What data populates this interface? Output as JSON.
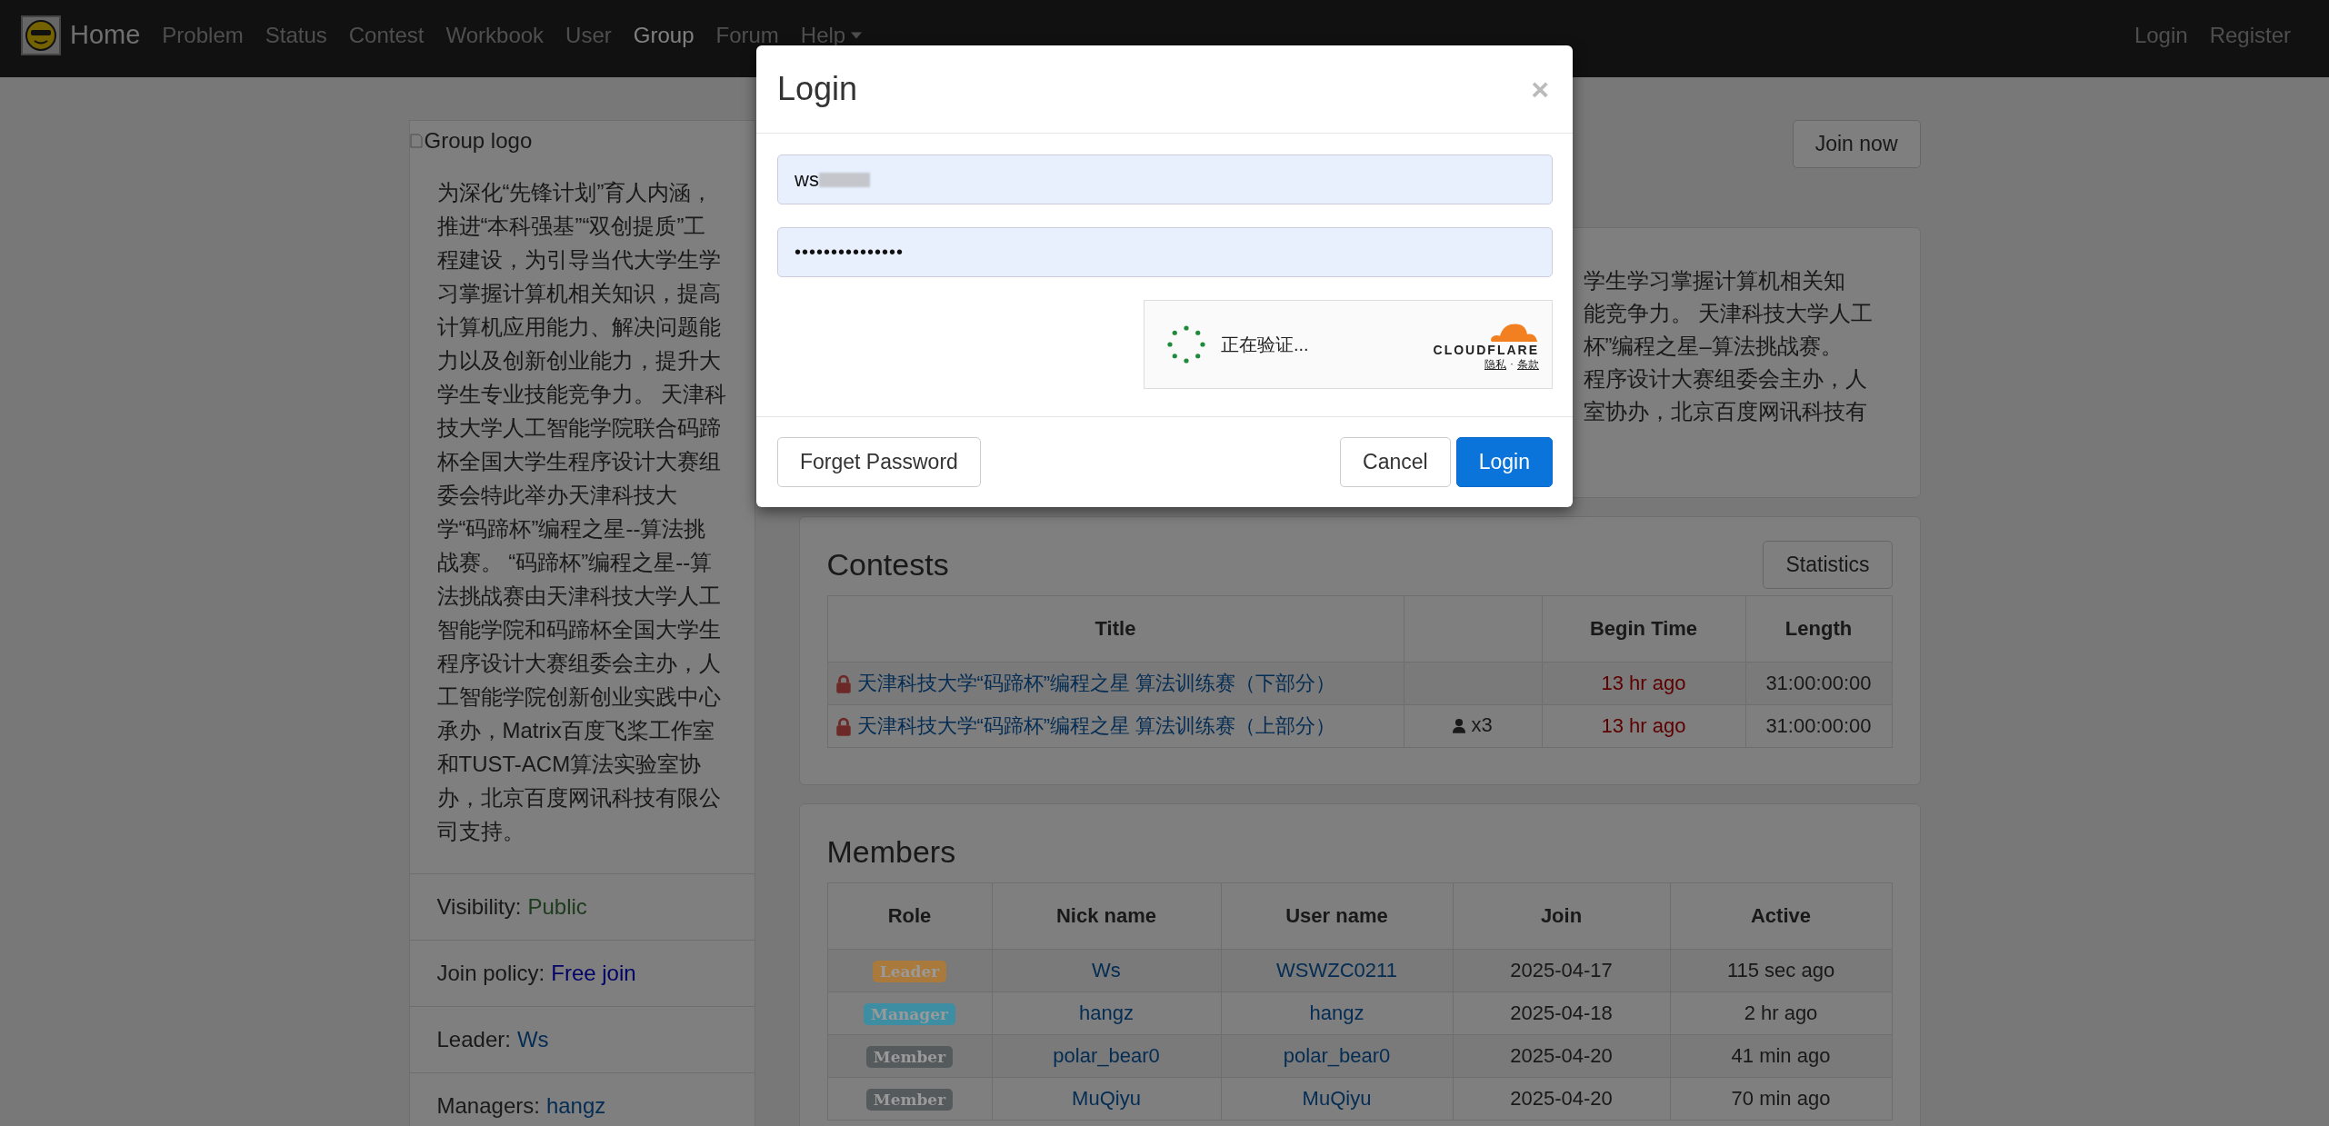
{
  "navbar": {
    "brand": "Home",
    "items": [
      {
        "label": "Problem",
        "selected": false,
        "dropdown": false
      },
      {
        "label": "Status",
        "selected": false,
        "dropdown": false
      },
      {
        "label": "Contest",
        "selected": false,
        "dropdown": false
      },
      {
        "label": "Workbook",
        "selected": false,
        "dropdown": false
      },
      {
        "label": "User",
        "selected": false,
        "dropdown": false
      },
      {
        "label": "Group",
        "selected": true,
        "dropdown": false
      },
      {
        "label": "Forum",
        "selected": false,
        "dropdown": false
      },
      {
        "label": "Help",
        "selected": false,
        "dropdown": true
      }
    ],
    "right_items": [
      "Login",
      "Register"
    ]
  },
  "sidebar": {
    "logo_alt": "Group logo",
    "description": "为深化“先锋计划”育人内涵，推进“本科强基”“双创提质”工程建设，为引导当代大学生学习掌握计算机相关知识，提高计算机应用能力、解决问题能力以及创新创业能力，提升大学生专业技能竞争力。 天津科技大学人工智能学院联合码蹄杯全国大学生程序设计大赛组委会特此举办天津科技大学“码蹄杯”编程之星--算法挑战赛。 “码蹄杯”编程之星--算法挑战赛由天津科技大学人工智能学院和码蹄杯全国大学生程序设计大赛组委会主办，人工智能学院创新创业实践中心承办，Matrix百度飞桨工作室和TUST-ACM算法实验室协办，北京百度网讯科技有限公司支持。",
    "info": [
      {
        "label": "Visibility:",
        "value": "Public",
        "kind": "success"
      },
      {
        "label": "Join policy:",
        "value": "Free join",
        "kind": "primary"
      },
      {
        "label": "Leader:",
        "value": "Ws",
        "kind": "link"
      },
      {
        "label": "Managers:",
        "value": "hangz",
        "kind": "link"
      }
    ]
  },
  "join_button": "Join now",
  "description_card": {
    "lines": [
      "学生学习掌握计算机相关知",
      "能竞争力。 天津科技大学人工",
      "杯”编程之星–算法挑战赛。",
      "程序设计大赛组委会主办，人",
      "室协办，北京百度网讯科技有"
    ]
  },
  "contests": {
    "title": "Contests",
    "button": "Statistics",
    "columns": [
      "Title",
      "Begin Time",
      "Length"
    ],
    "rows": [
      {
        "title": "天津科技大学“码蹄杯”编程之星 算法训练赛（下部分）",
        "locked": true,
        "begin_time": "13 hr ago",
        "length": "31:00:00:00"
      },
      {
        "title": "天津科技大学“码蹄杯”编程之星 算法训练赛（上部分）",
        "locked": true,
        "participants": "x3",
        "begin_time": "13 hr ago",
        "length": "31:00:00:00"
      }
    ]
  },
  "members": {
    "title": "Members",
    "columns": [
      "Role",
      "Nick name",
      "User name",
      "Join",
      "Active"
    ],
    "rows": [
      {
        "role": "Leader",
        "color": "#a97a3c",
        "nick": "Ws",
        "user": "WSWZC0211",
        "join": "2025-04-17",
        "active": "115 sec ago"
      },
      {
        "role": "Manager",
        "color": "#3d8ea3",
        "nick": "hangz",
        "user": "hangz",
        "join": "2025-04-18",
        "active": "2 hr ago"
      },
      {
        "role": "Member",
        "color": "#555a5c",
        "nick": "polar_bear0",
        "user": "polar_bear0",
        "join": "2025-04-20",
        "active": "41 min ago"
      },
      {
        "role": "Member",
        "color": "#555a5c",
        "nick": "MuQiyu",
        "user": "MuQiyu",
        "join": "2025-04-20",
        "active": "70 min ago"
      }
    ]
  },
  "login_modal": {
    "title": "Login",
    "close": "×",
    "username": "ws",
    "username_redacted": true,
    "password": "•••••••••••••••",
    "captcha": {
      "status": "正在验证...",
      "brand": "CLOUDFLARE",
      "links": [
        "隐私",
        "条款"
      ],
      "separator": "·"
    },
    "buttons": [
      {
        "label": "Forget Password",
        "kind": "default"
      },
      {
        "label": "Cancel",
        "kind": "default"
      },
      {
        "label": "Login",
        "kind": "primary"
      }
    ]
  }
}
